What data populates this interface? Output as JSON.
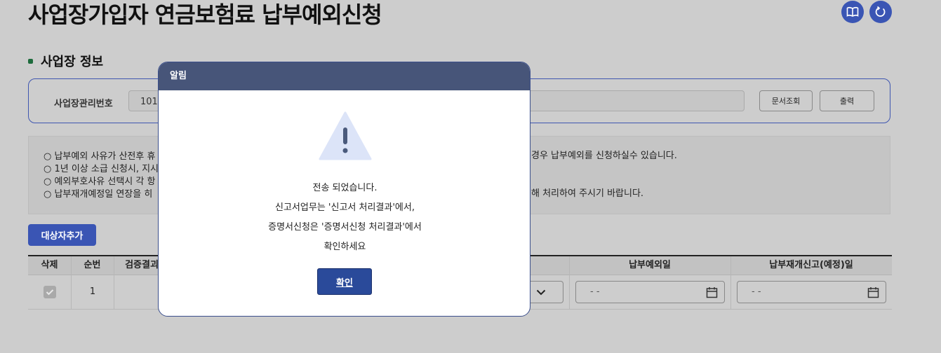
{
  "page": {
    "title": "사업장가입자 연금보험료 납부예외신청",
    "section_title": "사업장 정보",
    "icons": [
      "book-icon",
      "refresh-icon"
    ]
  },
  "business_info": {
    "label": "사업장관리번호",
    "value": "101",
    "doc_button": "문서조회",
    "print_button": "출력"
  },
  "notices": [
    "○ 납부예외 사유가 산전후 휴",
    "○ 1년 이상 소급 신청시, 지시",
    "○ 예외부호사유 선택시 각 항",
    "○ 납부재개예정일 연장을 히"
  ],
  "notices_right": [
    "경우 납부예외를 신청하실수 있습니다.",
    "",
    "",
    "해 처리하여 주시기 바랍니다."
  ],
  "add_button": "대상자추가",
  "table": {
    "headers": {
      "delete": "삭제",
      "no": "순번",
      "verify": "검증결괴",
      "exempt_date": "납부예외일",
      "resume_date": "납부재개신고(예정)일"
    },
    "row": {
      "no": "1",
      "exempt_date": "- -",
      "resume_date": "- -"
    }
  },
  "modal": {
    "title": "알림",
    "messages": [
      "전송 되었습니다.",
      "신고서업무는 '신고서 처리결과'에서,",
      "증명서신청은 '증명서신청 처리결과'에서",
      "확인하세요"
    ],
    "ok_button": "확인"
  },
  "colors": {
    "accent": "#3a55b4",
    "modal_header": "#475579",
    "ok_button": "#2a4a9a"
  }
}
